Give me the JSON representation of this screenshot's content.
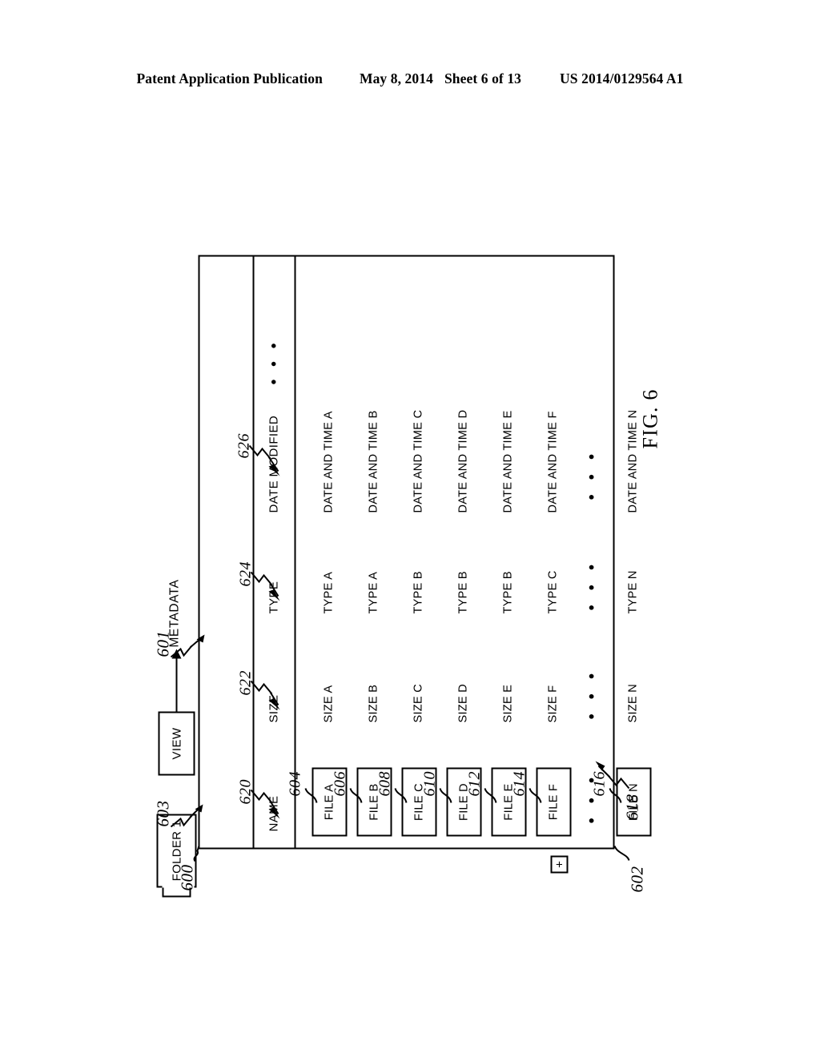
{
  "page_header": {
    "publication": "Patent Application Publication",
    "date": "May 8, 2014",
    "sheet": "Sheet 6 of 13",
    "doc_number": "US 2014/0129564 A1"
  },
  "figure": {
    "caption": "FIG. 6",
    "toolbar": {
      "folder_tab_label": "FOLDER 1",
      "view_button_label": "VIEW",
      "metadata_label": "METADATA"
    },
    "columns": [
      {
        "label": "NAME",
        "ref": "620"
      },
      {
        "label": "SIZE",
        "ref": "622"
      },
      {
        "label": "TYPE",
        "ref": "624"
      },
      {
        "label": "DATE MODIFIED",
        "ref": "626"
      }
    ],
    "header_ellipsis": "• • •",
    "rows": [
      {
        "name": "FILE A",
        "ref": "604",
        "size": "SIZE A",
        "type": "TYPE A",
        "date": "DATE AND TIME A"
      },
      {
        "name": "FILE B",
        "ref": "606",
        "size": "SIZE B",
        "type": "TYPE A",
        "date": "DATE AND TIME B"
      },
      {
        "name": "FILE C",
        "ref": "608",
        "size": "SIZE C",
        "type": "TYPE B",
        "date": "DATE AND TIME C"
      },
      {
        "name": "FILE D",
        "ref": "610",
        "size": "SIZE D",
        "type": "TYPE B",
        "date": "DATE AND TIME D"
      },
      {
        "name": "FILE E",
        "ref": "612",
        "size": "SIZE E",
        "type": "TYPE B",
        "date": "DATE AND TIME E"
      },
      {
        "name": "FILE F",
        "ref": "614",
        "size": "SIZE F",
        "type": "TYPE C",
        "date": "DATE AND TIME F"
      },
      {
        "name": "FILE N",
        "ref": "616",
        "size": "SIZE N",
        "type": "TYPE N",
        "date": "DATE AND TIME N"
      }
    ],
    "ellipsis_row": {
      "name": "• • •",
      "size": "• • •",
      "type": "• • •",
      "date": "• • •"
    },
    "expander_label": "+",
    "reference_numerals": {
      "window": "600",
      "content_area": "601",
      "folder_tab": "602",
      "toolbar_band": "603",
      "view_button": "618"
    }
  }
}
